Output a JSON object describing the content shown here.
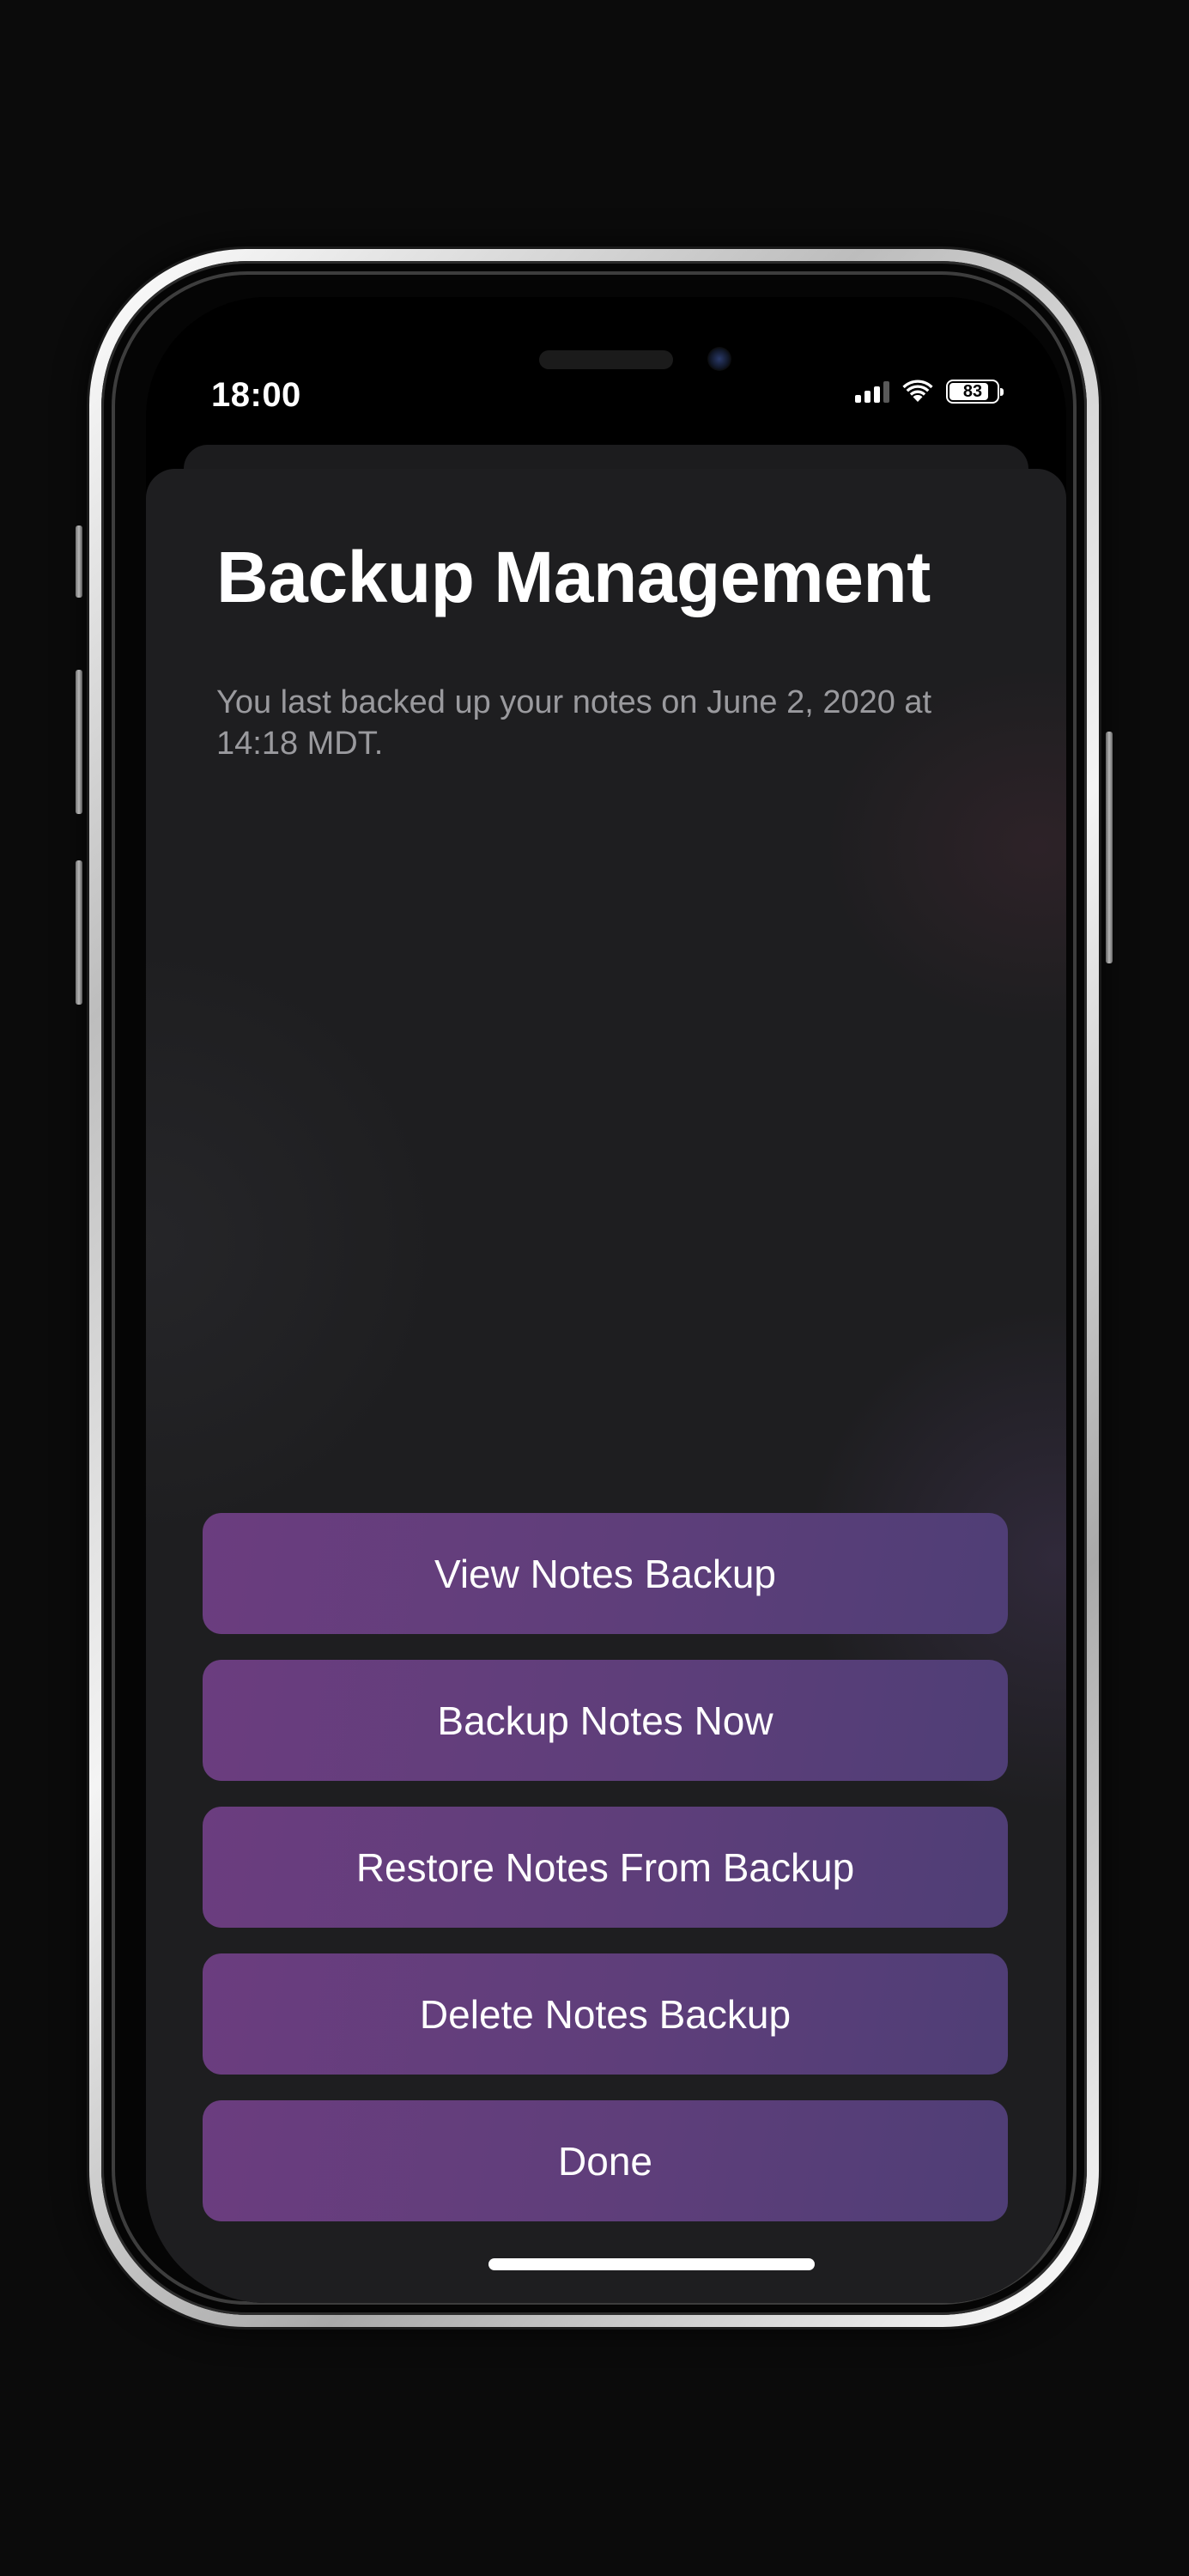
{
  "status_bar": {
    "time": "18:00",
    "battery_level": "83",
    "battery_fraction": 0.83
  },
  "icons": {
    "signal": "cellular-signal-icon",
    "wifi": "wifi-icon",
    "battery": "battery-icon"
  },
  "sheet": {
    "title": "Backup Management",
    "subtitle": "You last backed up your notes on June 2, 2020 at 14:18 MDT."
  },
  "actions": {
    "view_label": "View Notes Backup",
    "backup_label": "Backup Notes Now",
    "restore_label": "Restore Notes From Backup",
    "delete_label": "Delete Notes Backup",
    "done_label": "Done"
  },
  "colors": {
    "background": "#0b0b0b",
    "sheet": "#1e1e20",
    "button_start": "#6b3d7f",
    "button_end": "#4f3e76",
    "text_primary": "#ffffff",
    "text_secondary": "#9a9a9e"
  }
}
